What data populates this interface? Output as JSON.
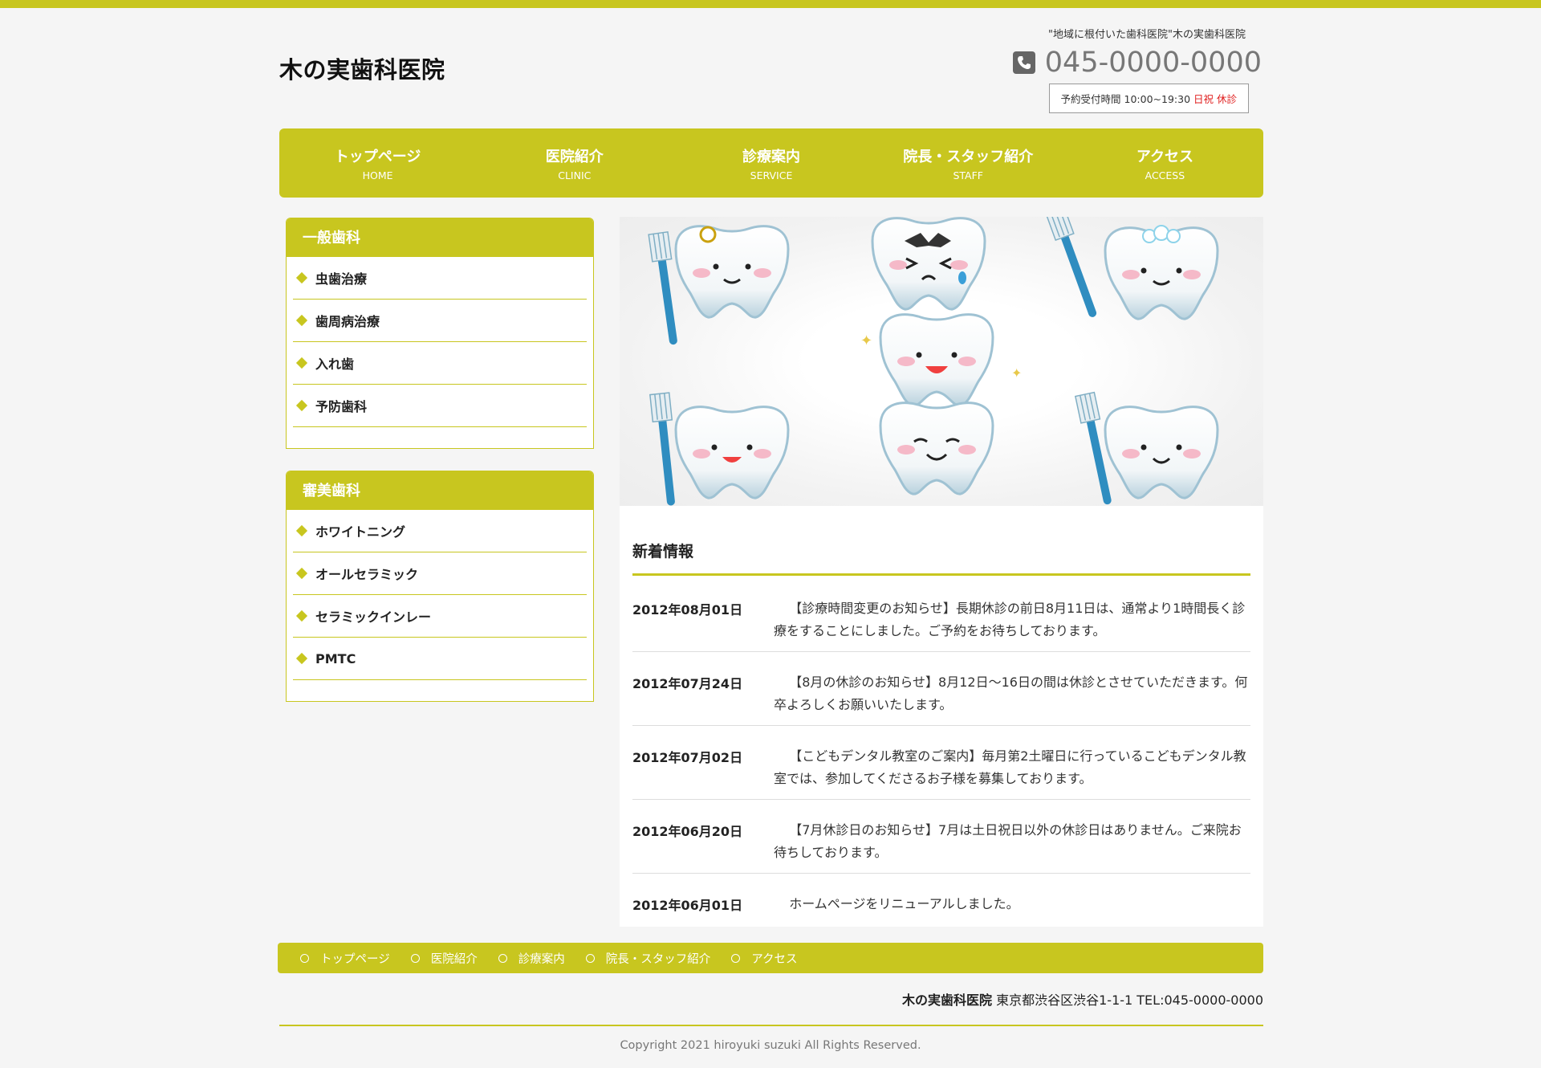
{
  "header": {
    "site_title": "木の実歯科医院",
    "tagline": "\"地域に根付いた歯科医院\"木の実歯科医院",
    "phone": "045-0000-0000",
    "hours_label": "予約受付時間 10:00~19:30",
    "closed_label": "日祝 休診"
  },
  "nav": [
    {
      "jp": "トップページ",
      "en": "HOME"
    },
    {
      "jp": "医院紹介",
      "en": "CLINIC"
    },
    {
      "jp": "診療案内",
      "en": "SERVICE"
    },
    {
      "jp": "院長・スタッフ紹介",
      "en": "STAFF"
    },
    {
      "jp": "アクセス",
      "en": "ACCESS"
    }
  ],
  "sidebar": {
    "general": {
      "title": "一般歯科",
      "items": [
        "虫歯治療",
        "歯周病治療",
        "入れ歯",
        "予防歯科"
      ]
    },
    "cosmetic": {
      "title": "審美歯科",
      "items": [
        "ホワイトニング",
        "オールセラミック",
        "セラミックインレー",
        "PMTC"
      ]
    }
  },
  "news": {
    "title": "新着情報",
    "items": [
      {
        "date": "2012年08月01日",
        "text": "【診療時間変更のお知らせ】長期休診の前日8月11日は、通常より1時間長く診療をすることにしました。ご予約をお待ちしております。"
      },
      {
        "date": "2012年07月24日",
        "text": "【8月の休診のお知らせ】8月12日～16日の間は休診とさせていただきます。何卒よろしくお願いいたします。"
      },
      {
        "date": "2012年07月02日",
        "text": "【こどもデンタル教室のご案内】毎月第2土曜日に行っているこどもデンタル教室では、参加してくださるお子様を募集しております。"
      },
      {
        "date": "2012年06月20日",
        "text": "【7月休診日のお知らせ】7月は土日祝日以外の休診日はありません。ご来院お待ちしております。"
      },
      {
        "date": "2012年06月01日",
        "text": "ホームページをリニューアルしました。"
      }
    ]
  },
  "footer_nav": [
    "トップページ",
    "医院紹介",
    "診療案内",
    "院長・スタッフ紹介",
    "アクセス"
  ],
  "footer": {
    "clinic_name": "木の実歯科医院",
    "address": "東京都渋谷区渋谷1-1-1 TEL:045-0000-0000",
    "copyright": "Copyright 2021 hiroyuki suzuki All Rights Reserved."
  },
  "colors": {
    "accent": "#c8c61f",
    "closed_text": "#e02020",
    "background": "#f5f5f5"
  },
  "icons": [
    "phone-icon",
    "diamond-bullet-icon",
    "circle-bullet-icon",
    "tooth-character-icon",
    "toothbrush-icon"
  ]
}
